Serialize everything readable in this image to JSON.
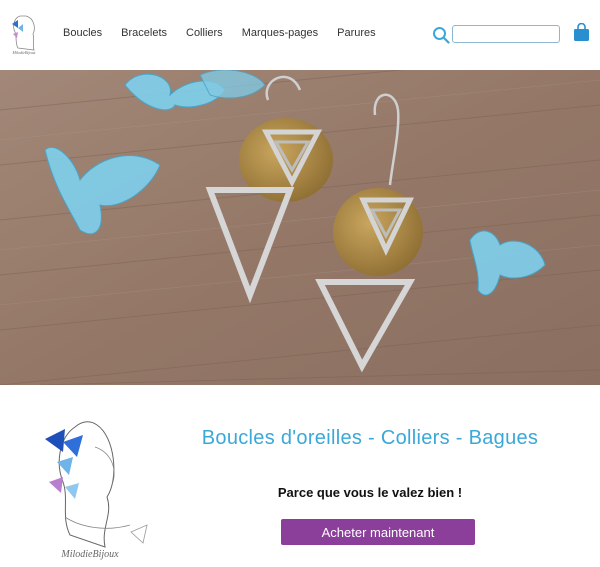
{
  "brand": {
    "logo_text": "MilodieBijoux"
  },
  "nav": {
    "items": [
      {
        "label": "Boucles"
      },
      {
        "label": "Bracelets"
      },
      {
        "label": "Colliers"
      },
      {
        "label": "Marques-pages"
      },
      {
        "label": "Parures"
      }
    ]
  },
  "search": {
    "placeholder": "",
    "value": "",
    "icon": "search-icon"
  },
  "cart": {
    "icon": "shopping-bag-icon"
  },
  "hero": {
    "image": "earrings-photo"
  },
  "promo": {
    "headline": "Boucles d'oreilles - Colliers - Bagues",
    "tagline": "Parce que vous le valez bien !",
    "cta_label": "Acheter maintenant"
  },
  "colors": {
    "accent": "#3aa8d8",
    "button": "#8b3e9a",
    "wood": "#9a8070"
  }
}
